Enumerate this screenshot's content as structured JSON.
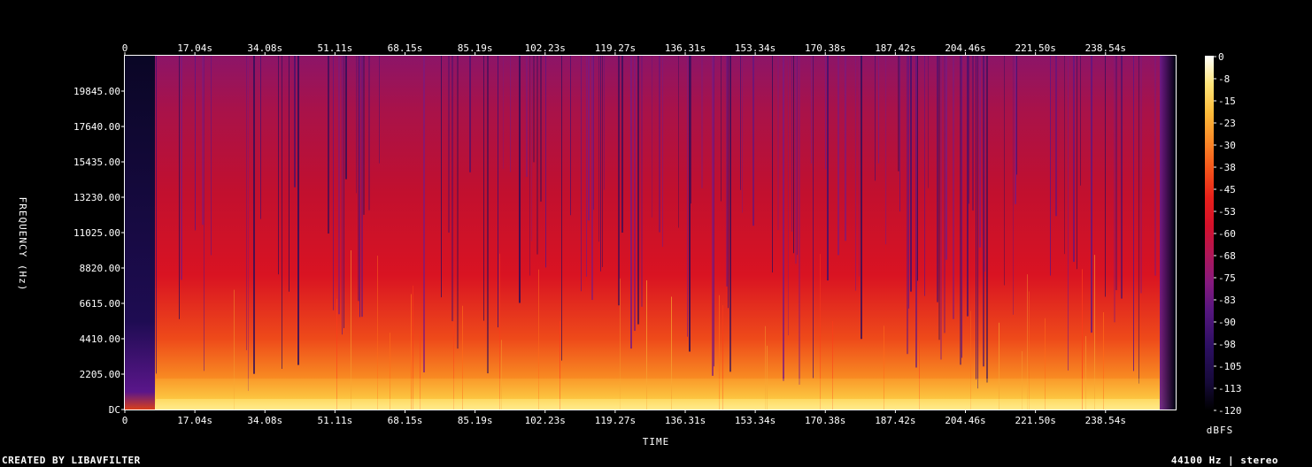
{
  "chart_data": {
    "type": "heatmap",
    "xlabel": "TIME",
    "ylabel": "FREQUENCY (Hz)",
    "x_ticks": [
      "0",
      "17.04s",
      "34.08s",
      "51.11s",
      "68.15s",
      "85.19s",
      "102.23s",
      "119.27s",
      "136.31s",
      "153.34s",
      "170.38s",
      "187.42s",
      "204.46s",
      "221.50s",
      "238.54s"
    ],
    "y_ticks": [
      "DC",
      "2205.00",
      "4410.00",
      "6615.00",
      "8820.00",
      "11025.00",
      "13230.00",
      "15435.00",
      "17640.00",
      "19845.00"
    ],
    "y_values_hz": [
      0,
      2205,
      4410,
      6615,
      8820,
      11025,
      13230,
      15435,
      17640,
      19845
    ],
    "x_values_s": [
      0,
      17.04,
      34.08,
      51.11,
      68.15,
      85.19,
      102.23,
      119.27,
      136.31,
      153.34,
      170.38,
      187.42,
      204.46,
      221.5,
      238.54
    ],
    "xlim": [
      0,
      255.6
    ],
    "ylim": [
      0,
      22050
    ],
    "colorbar": {
      "label": "dBFS",
      "ticks": [
        "0",
        "-8",
        "-15",
        "-23",
        "-30",
        "-38",
        "-45",
        "-53",
        "-60",
        "-68",
        "-75",
        "-83",
        "-90",
        "-98",
        "-105",
        "-113",
        "-120"
      ],
      "range": [
        -120,
        0
      ],
      "colormap": [
        "#000000",
        "#160a3a",
        "#3b0f70",
        "#6a1a8a",
        "#9c1a6a",
        "#c8102e",
        "#e31a1c",
        "#f03b20",
        "#fd8d3c",
        "#fec44f",
        "#ffe97a",
        "#ffffff"
      ]
    }
  },
  "footer": {
    "left": "CREATED BY LIBAVFILTER",
    "right": "44100 Hz | stereo"
  }
}
